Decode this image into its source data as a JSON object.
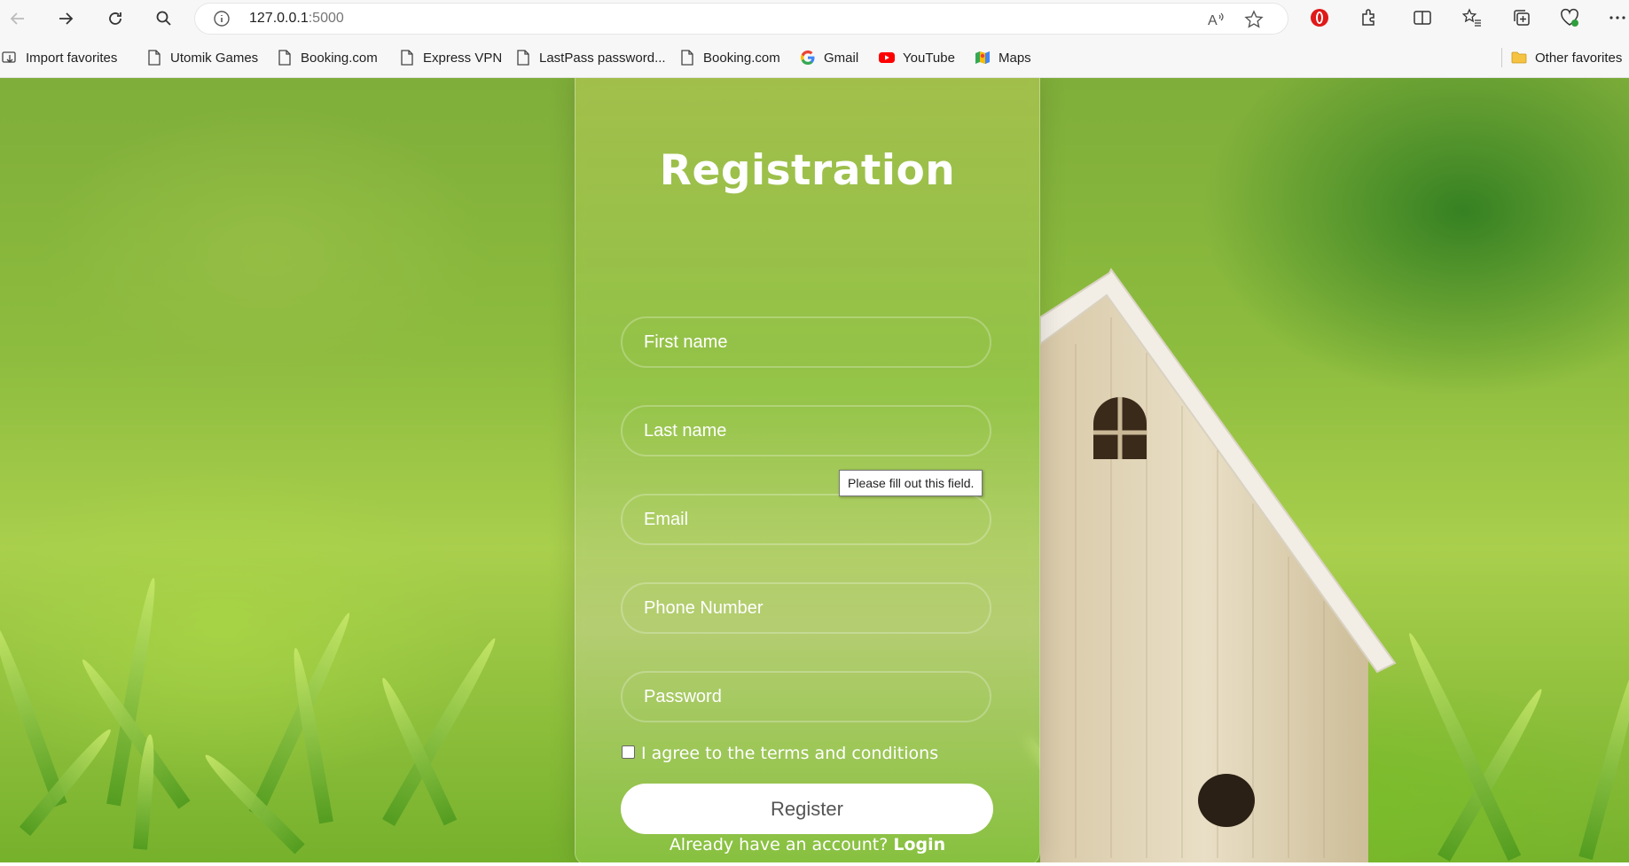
{
  "browser": {
    "url_host": "127.0.0.1",
    "url_port": ":5000"
  },
  "favorites": [
    {
      "label": "Import favorites",
      "icon": "import-icon"
    },
    {
      "label": "Utomik Games",
      "icon": "page-icon"
    },
    {
      "label": "Booking.com",
      "icon": "page-icon"
    },
    {
      "label": "Express VPN",
      "icon": "page-icon"
    },
    {
      "label": "LastPass password...",
      "icon": "page-icon"
    },
    {
      "label": "Booking.com",
      "icon": "page-icon"
    },
    {
      "label": "Gmail",
      "icon": "google-icon"
    },
    {
      "label": "YouTube",
      "icon": "youtube-icon"
    },
    {
      "label": "Maps",
      "icon": "maps-icon"
    }
  ],
  "other_favorites": "Other favorites",
  "form": {
    "title": "Registration",
    "first_name_placeholder": "First name",
    "last_name_placeholder": "Last name",
    "email_placeholder": "Email",
    "phone_placeholder": "Phone Number",
    "password_placeholder": "Password",
    "validation_tooltip": "Please fill out this field.",
    "terms_label": "I agree to the terms and conditions",
    "terms_checked": false,
    "register_label": "Register",
    "login_prompt": "Already have an account?",
    "login_link": "Login"
  }
}
